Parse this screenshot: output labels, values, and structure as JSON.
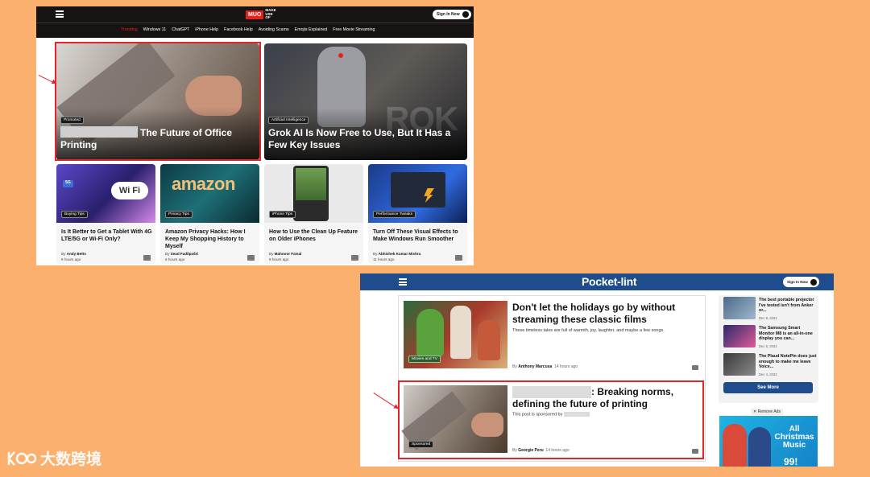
{
  "colors": {
    "background": "#fbb06e",
    "highlight": "#e0262b",
    "muo_bar": "#171313",
    "muo_accent": "#e2231a",
    "pocketlint_bar": "#1f4c8c"
  },
  "muo": {
    "logo_mark": "MUO",
    "logo_text": "MAKE USE OF",
    "sign_in": "Sign In Now",
    "nav": [
      "Trending",
      "Windows 11",
      "ChatGPT",
      "iPhone Help",
      "Facebook Help",
      "Avoiding Scams",
      "Emojis Explained",
      "Free Movie Streaming"
    ],
    "featured": [
      {
        "tag": "Promoted",
        "title": "The Future of Office Printing"
      },
      {
        "tag": "Artificial Intelligence",
        "title": "Grok AI Is Now Free to Use, But It Has a Few Key Issues"
      }
    ],
    "cards": [
      {
        "tag": "Buying Tips",
        "title": "Is It Better to Get a Tablet With 4G LTE/5G or Wi-Fi Only?",
        "author": "Andy Betts",
        "time": "8 hours ago",
        "image_text": "Wi Fi"
      },
      {
        "tag": "Privacy Tips",
        "title": "Amazon Privacy Hacks: How I Keep My Shopping History to Myself",
        "author": "Sead Fadilpašić",
        "time": "6 hours ago",
        "image_text": "amazon"
      },
      {
        "tag": "iPhone Tips",
        "title": "How to Use the Clean Up Feature on Older iPhones",
        "author": "Mahnoor Faisal",
        "time": "8 hours ago"
      },
      {
        "tag": "Performance Tweaks",
        "title": "Turn Off These Visual Effects to Make Windows Run Smoother",
        "author": "Abhishek Kumar Mishra",
        "time": "11 hours ago"
      }
    ]
  },
  "pocketlint": {
    "brand": "Pocket-lint",
    "sign_in": "Sign In Now",
    "articles": [
      {
        "title": "Don't let the holidays go by without streaming these classic films",
        "desc": "These timeless tales are full of warmth, joy, laughter, and maybe a few songs.",
        "tag": "Movies and TV",
        "author": "Anthony Marcusa",
        "time": "14 hours ago"
      },
      {
        "title": ": Breaking norms, defining the future of printing",
        "desc": "This post is sponsored by",
        "tag": "Sponsored",
        "author": "Georgie Peru",
        "time": "14 hours ago"
      }
    ],
    "sidebar": [
      {
        "title": "The best portable projector I've tested isn't from Anker or...",
        "date": "Dec 8, 2024"
      },
      {
        "title": "The Samsung Smart Monitor M8 is an all-in-one display you can...",
        "date": "Dec 5, 2024"
      },
      {
        "title": "The Plaud NotePin does just enough to make me leave Voice...",
        "date": "Dec 4, 2024"
      }
    ],
    "see_more": "See More",
    "remove_ads": "Remove Ads",
    "ad_text": "All Christmas Music",
    "ad_number": "99!"
  },
  "watermark": "大数跨境"
}
